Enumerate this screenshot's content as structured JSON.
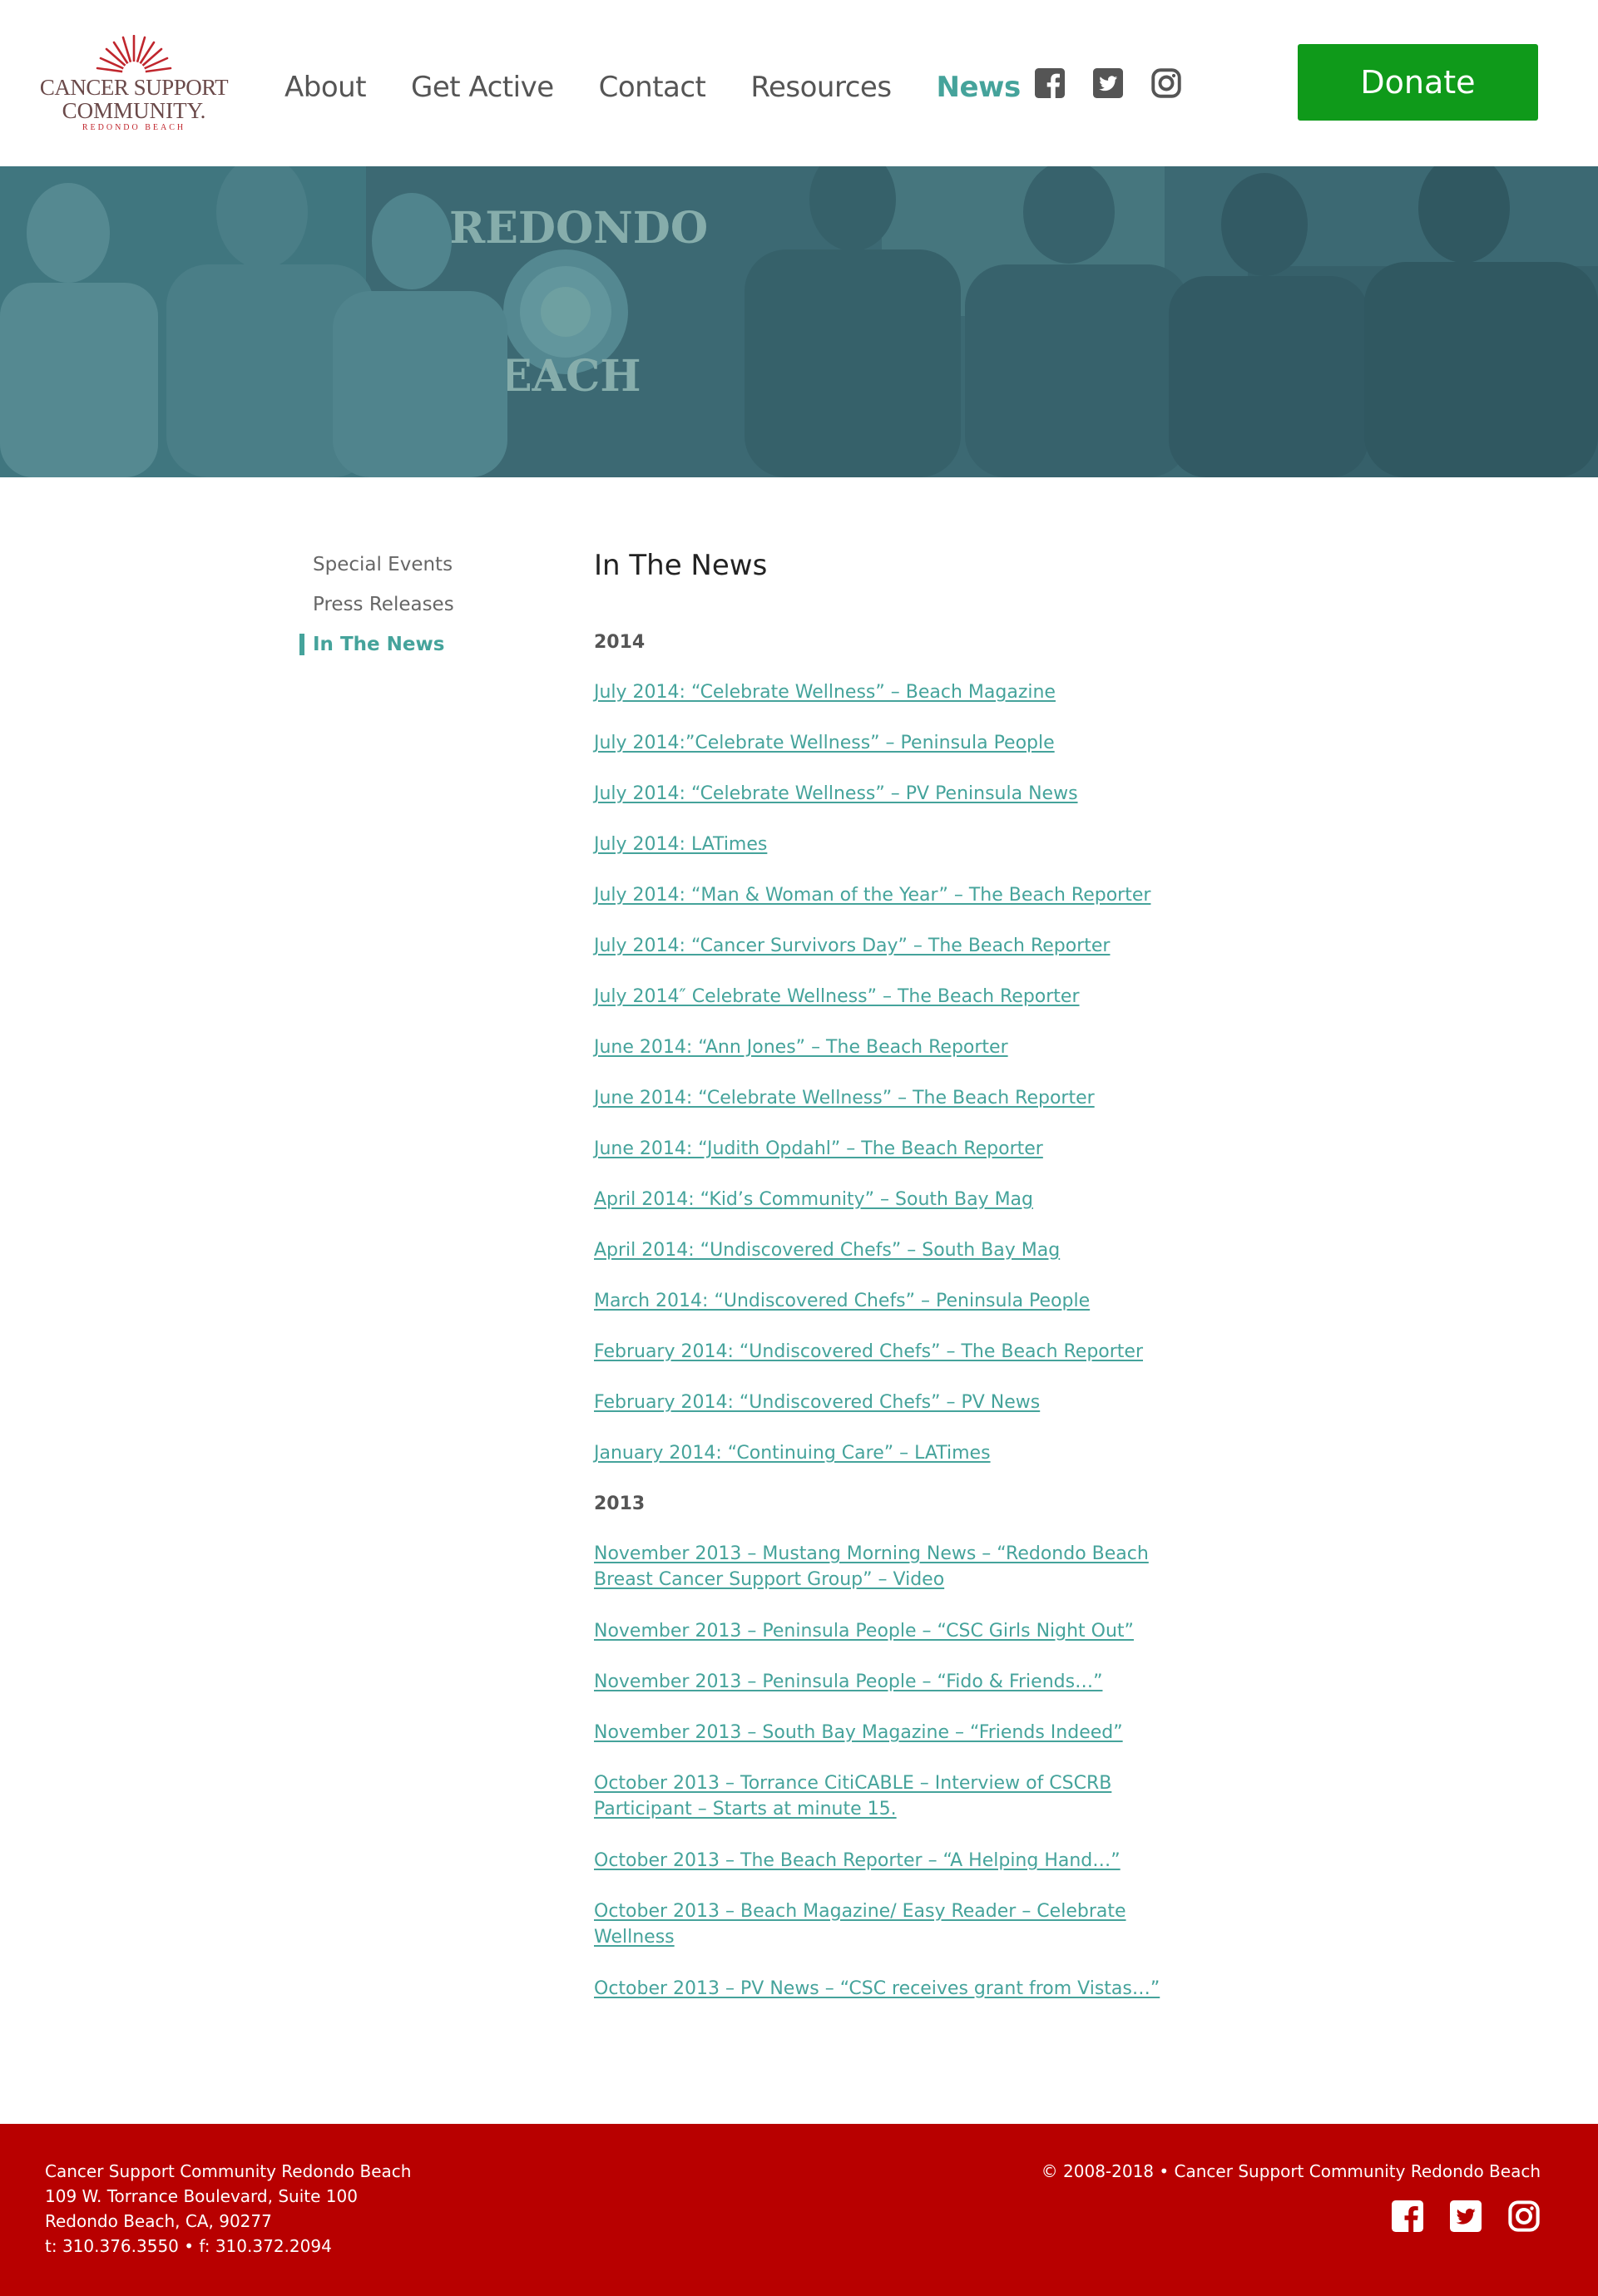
{
  "brand": {
    "line1": "CANCER SUPPORT",
    "line2": "COMMUNITY.",
    "line3": "REDONDO BEACH",
    "red": "#c0262d",
    "teal": "#45a39b",
    "green": "#0f9a1a",
    "footer_red": "#b80000"
  },
  "nav": {
    "items": [
      {
        "label": "About"
      },
      {
        "label": "Get Active"
      },
      {
        "label": "Contact"
      },
      {
        "label": "Resources"
      },
      {
        "label": "News",
        "active": true
      }
    ],
    "social": [
      "facebook-icon",
      "twitter-icon",
      "instagram-icon"
    ],
    "donate_label": "Donate"
  },
  "hero": {
    "sign_text_1": "REDONDO",
    "sign_text_2": "EACH"
  },
  "sidebar": {
    "items": [
      {
        "label": "Special Events"
      },
      {
        "label": "Press Releases"
      },
      {
        "label": "In The News",
        "active": true
      }
    ]
  },
  "main": {
    "title": "In The News",
    "sections": [
      {
        "year": "2014",
        "links": [
          "July 2014: “Celebrate Wellness” – Beach Magazine",
          "July 2014:”Celebrate Wellness” –  Peninsula People",
          "July 2014: “Celebrate Wellness” – PV Peninsula News",
          "July 2014: LATimes",
          "July 2014: “Man & Woman of the Year” – The Beach Reporter",
          "July 2014: “Cancer Survivors Day” – The Beach Reporter",
          "July 2014″ Celebrate Wellness” – The Beach Reporter",
          "June 2014: “Ann Jones” – The Beach Reporter",
          "June 2014: “Celebrate Wellness” – The Beach Reporter",
          "June 2014: “Judith Opdahl” – The Beach Reporter",
          "April 2014: “Kid’s Community” – South Bay Mag",
          "April 2014: “Undiscovered Chefs” – South Bay Mag",
          "March 2014: “Undiscovered Chefs” – Peninsula People",
          "February 2014: “Undiscovered Chefs” – The Beach Reporter",
          "February 2014: “Undiscovered Chefs” – PV News",
          "January 2014: “Continuing Care” – LATimes"
        ]
      },
      {
        "year": "2013",
        "links": [
          "November 2013 – Mustang Morning News – “Redondo Beach Breast Cancer Support Group” – Video",
          "November 2013 – Peninsula People – “CSC Girls Night Out”",
          "November 2013 – Peninsula People – “Fido & Friends…”",
          "November 2013 – South Bay Magazine – “Friends Indeed”",
          "October 2013 – Torrance CitiCABLE – Interview of CSCRB Participant – Starts at minute 15.",
          "October 2013 – The Beach Reporter – “A Helping Hand…”",
          "October 2013 – Beach Magazine/ Easy Reader – Celebrate Wellness",
          "October 2013 – PV News – “CSC receives grant from Vistas…”"
        ]
      }
    ]
  },
  "footer": {
    "org": "Cancer Support Community Redondo Beach",
    "address1": "109 W. Torrance Boulevard, Suite 100",
    "address2": "Redondo Beach, CA, 90277",
    "phone": "t: 310.376.3550 • f: 310.372.2094",
    "copyright": "© 2008-2018 • Cancer Support Community Redondo Beach",
    "social": [
      "facebook-icon",
      "twitter-icon",
      "instagram-icon"
    ]
  }
}
